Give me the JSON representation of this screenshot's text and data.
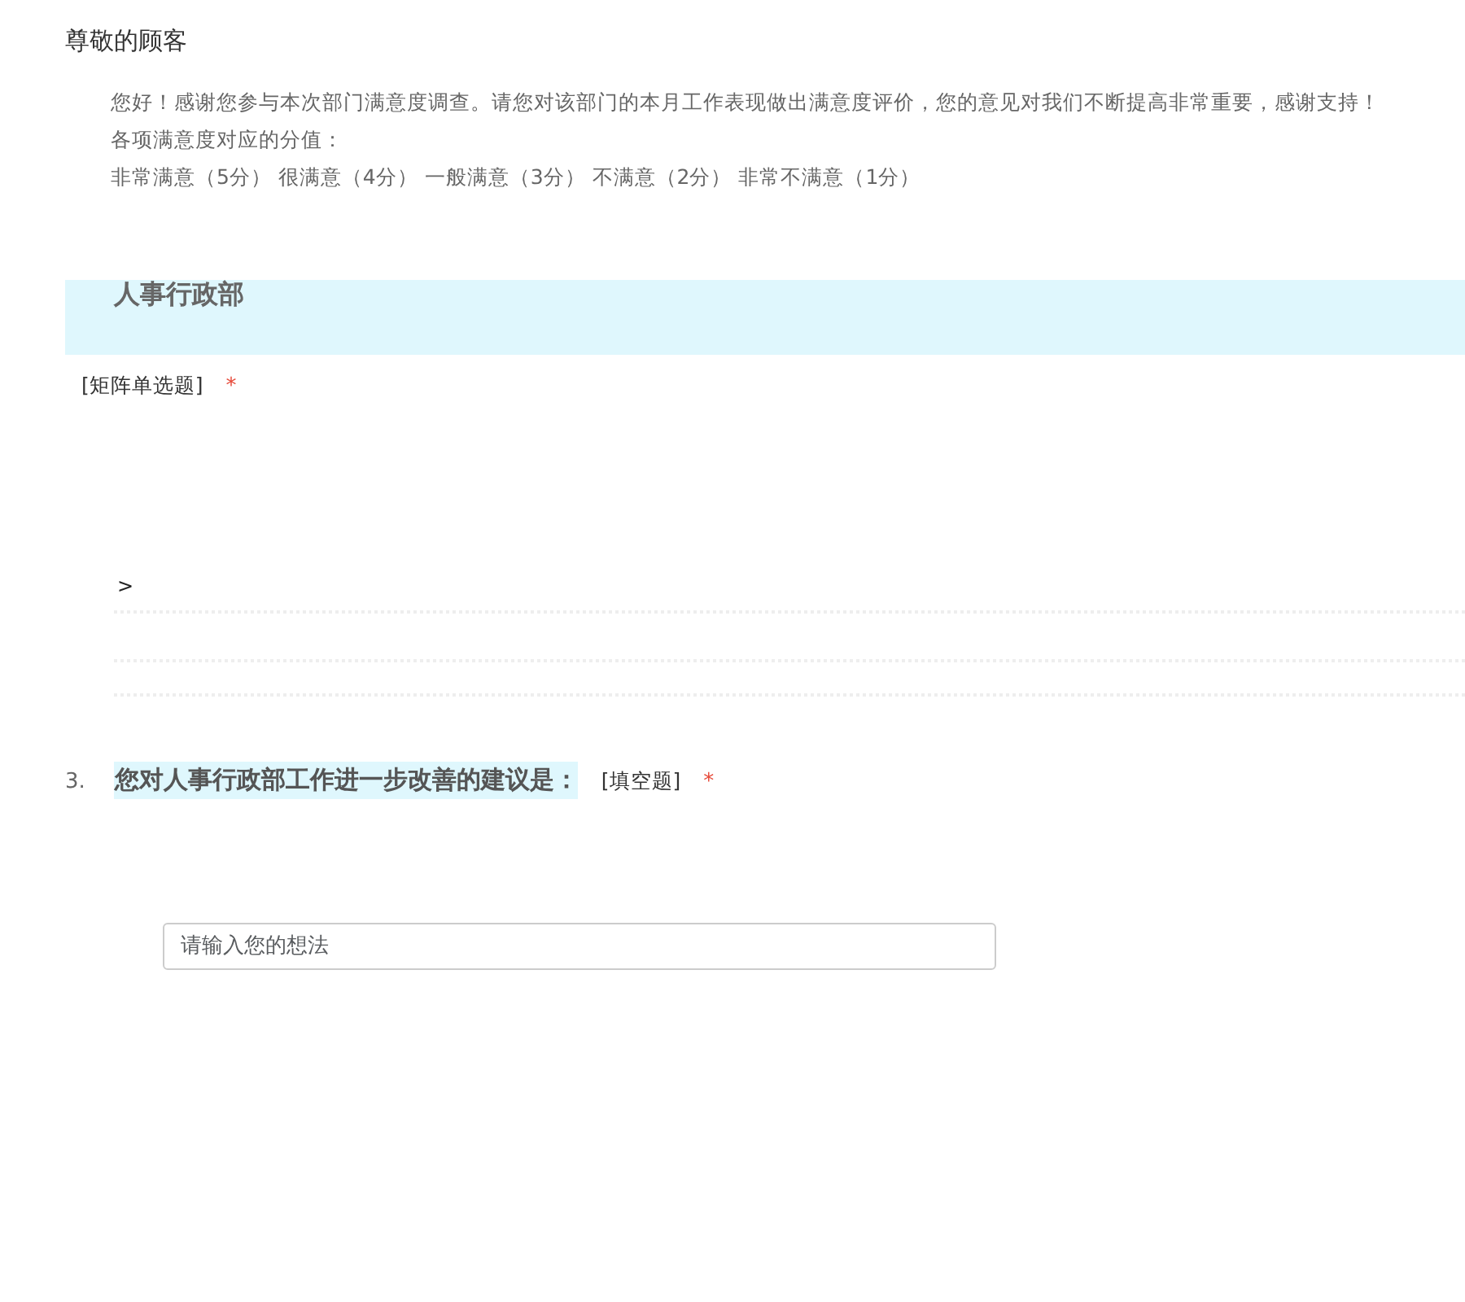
{
  "greeting": "尊敬的顾客",
  "intro": [
    "您好！感谢您参与本次部门满意度调查。请您对该部门的本月工作表现做出满意度评价，您的意见对我们不断提高非常重要，感谢支持！",
    "各项满意度对应的分值：",
    "非常满意（5分） 很满意（4分） 一般满意（3分） 不满意（2分） 非常不满意（1分）"
  ],
  "section": {
    "title": "人事行政部",
    "type": "[矩阵单选题]",
    "required": "*",
    "marker": ">"
  },
  "question": {
    "number": "3.",
    "text": "您对人事行政部工作进一步改善的建议是：",
    "type": "[填空题]",
    "required": "*",
    "placeholder": "请输入您的想法"
  }
}
